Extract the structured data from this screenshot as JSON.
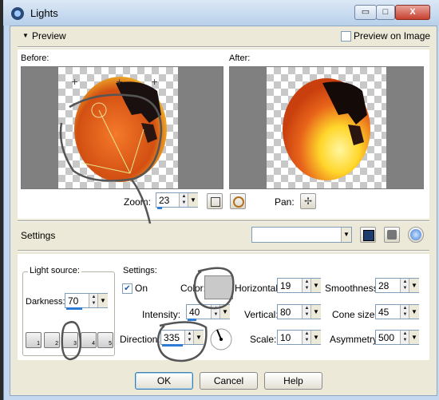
{
  "window": {
    "title": "Lights",
    "minimize": "▭",
    "maximize": "□",
    "close": "X"
  },
  "preview": {
    "toggle_label": "Preview",
    "preview_on_image_label": "Preview on Image",
    "before_label": "Before:",
    "after_label": "After:"
  },
  "zoom": {
    "label": "Zoom:",
    "value": "23",
    "percent": 23
  },
  "pan": {
    "label": "Pan:"
  },
  "settings_preset": {
    "label": "Settings",
    "value": ""
  },
  "light_source": {
    "group_label": "Light source:",
    "darkness_label": "Darkness:",
    "darkness_value": "70",
    "darkness_pct": 70,
    "buttons": [
      "1",
      "2",
      "3",
      "4",
      "5"
    ]
  },
  "settings": {
    "group_label": "Settings:",
    "on_label": "On",
    "on_checked": true,
    "color_label": "Color:",
    "color_value": "#c9c9c9",
    "intensity_label": "Intensity:",
    "intensity_value": "40",
    "intensity_pct": 40,
    "direction_label": "Direction:",
    "direction_value": "335",
    "direction_pct": 93,
    "horizontal_label": "Horizontal:",
    "horizontal_value": "19",
    "vertical_label": "Vertical:",
    "vertical_value": "80",
    "scale_label": "Scale:",
    "scale_value": "10",
    "smoothness_label": "Smoothness:",
    "smoothness_value": "28",
    "cone_size_label": "Cone size:",
    "cone_size_value": "45",
    "asymmetry_label": "Asymmetry:",
    "asymmetry_value": "500"
  },
  "buttons": {
    "ok": "OK",
    "cancel": "Cancel",
    "help": "Help"
  },
  "colors": {
    "accent_bar": "#2f7bd8",
    "moon_orange": "#e8641a",
    "moon_yellow": "#ffe24a",
    "annotation": "#555555"
  }
}
